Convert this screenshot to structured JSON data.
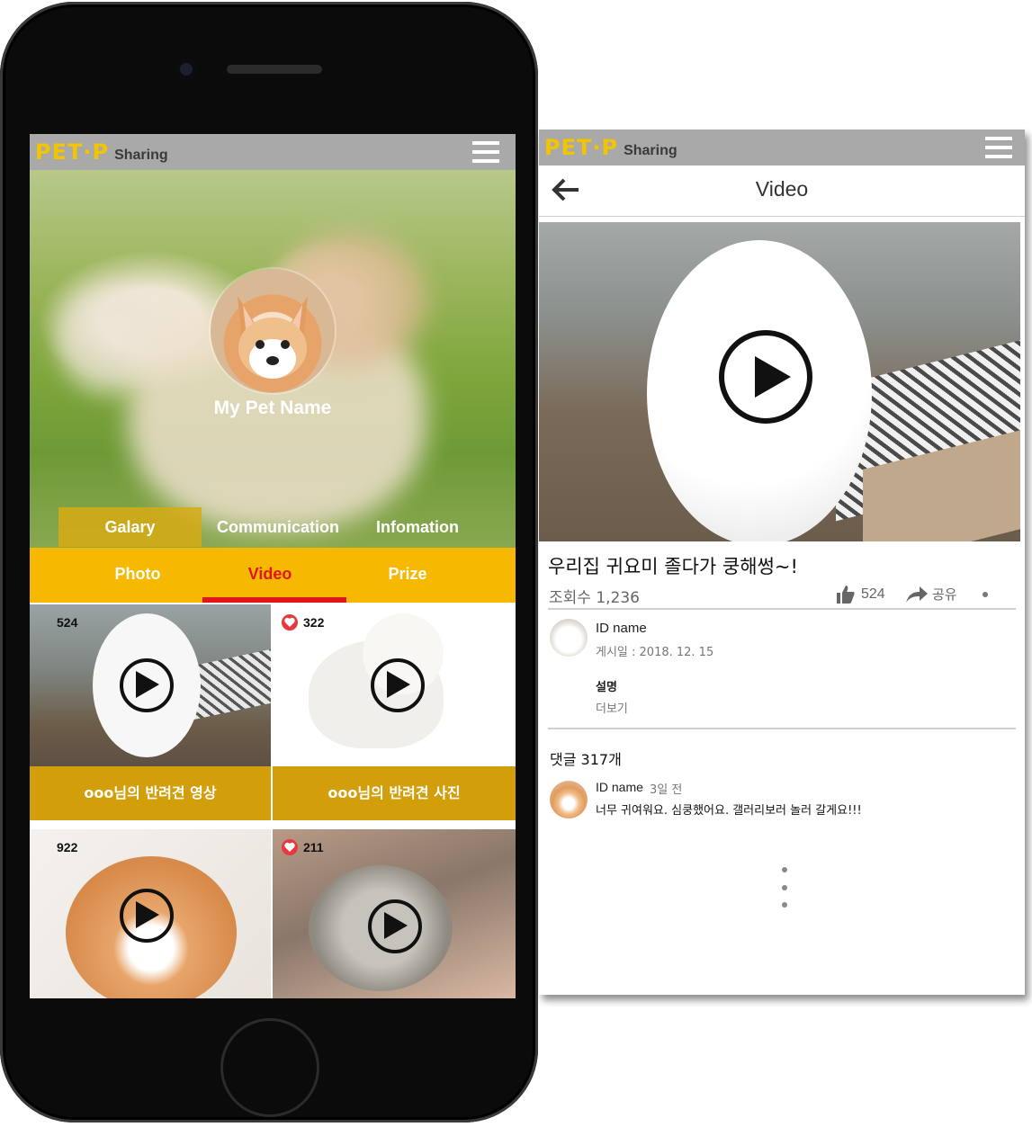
{
  "brand": {
    "logo_text": "PET·P",
    "logo_sub": "Sharing",
    "accent": "#f6b800",
    "active_red": "#e0161b"
  },
  "profile": {
    "pet_name": "My Pet Name",
    "main_tabs": [
      {
        "label": "Galary",
        "active": true
      },
      {
        "label": "Communication",
        "active": false
      },
      {
        "label": "Infomation",
        "active": false
      }
    ],
    "sub_tabs": [
      {
        "label": "Photo",
        "active": false
      },
      {
        "label": "Video",
        "active": true
      },
      {
        "label": "Prize",
        "active": false
      }
    ],
    "tiles": [
      {
        "count": "524",
        "liked": false,
        "caption": "ooo님의 반려견 영상"
      },
      {
        "count": "322",
        "liked": true,
        "caption": "ooo님의 반려견 사진"
      },
      {
        "count": "922",
        "liked": false
      },
      {
        "count": "211",
        "liked": true
      }
    ]
  },
  "detail": {
    "title": "Video",
    "video_title": "우리집 귀요미 졸다가 쿵해썽~!",
    "views": "조회수 1,236",
    "likes": "524",
    "share": "공유",
    "uploader": {
      "name": "ID name",
      "date": "게시일 : 2018. 12. 15"
    },
    "description_label": "설명",
    "more_label": "더보기",
    "comments_header": "댓글 317개",
    "comment": {
      "name": "ID name",
      "time": "3일 전",
      "text": "너무 귀여워요. 심쿵했어요. 갤러리보러 놀러 갈게요!!!"
    }
  }
}
